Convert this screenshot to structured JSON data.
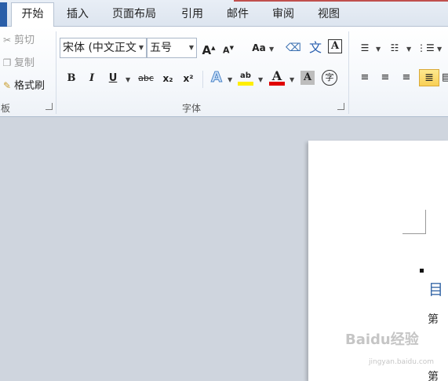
{
  "tabs": [
    {
      "label": "开始",
      "active": true
    },
    {
      "label": "插入"
    },
    {
      "label": "页面布局"
    },
    {
      "label": "引用"
    },
    {
      "label": "邮件"
    },
    {
      "label": "审阅"
    },
    {
      "label": "视图"
    }
  ],
  "clipboard": {
    "cut": "剪切",
    "copy": "复制",
    "format_painter": "格式刷",
    "group_label_partial": "板"
  },
  "font": {
    "font_name": "宋体 (中文正文",
    "font_size": "五号",
    "group_label": "字体",
    "buttons": {
      "bold": "B",
      "italic": "I",
      "underline": "U",
      "strikethrough": "abc",
      "subscript": "x₂",
      "superscript": "x²",
      "grow": "A",
      "shrink": "A",
      "change_case": "Aa",
      "phonetic": "文",
      "text_effect": "A",
      "highlight": "ab",
      "font_color": "A",
      "char_shading": "A",
      "enclose": "字"
    },
    "colors": {
      "highlight": "#ffee00",
      "font_color": "#e00000"
    }
  },
  "document": {
    "heading_partial": "目",
    "line1_partial": "第",
    "line2_partial": "第"
  },
  "watermark": {
    "logo": "Baidu经验",
    "url": "jingyan.baidu.com"
  }
}
